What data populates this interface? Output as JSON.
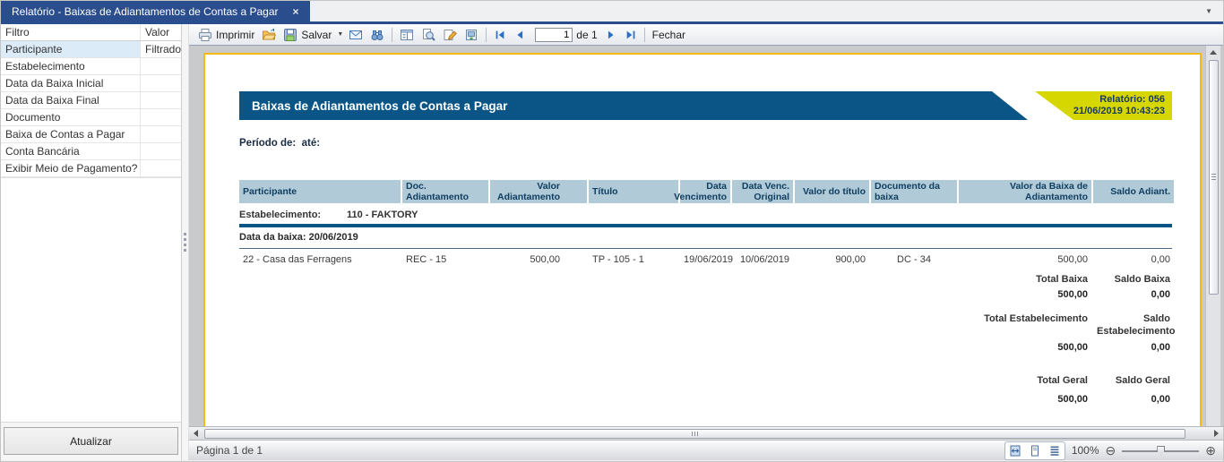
{
  "window": {
    "tab_title": "Relatório - Baixas de Adiantamentos de Contas a Pagar",
    "close_glyph": "×",
    "overflow_glyph": "▼"
  },
  "sidebar": {
    "header": {
      "filtro": "Filtro",
      "valor": "Valor"
    },
    "rows": [
      {
        "filtro": "Participante",
        "valor": "Filtrado"
      },
      {
        "filtro": "Estabelecimento",
        "valor": ""
      },
      {
        "filtro": "Data da Baixa Inicial",
        "valor": ""
      },
      {
        "filtro": "Data da Baixa Final",
        "valor": ""
      },
      {
        "filtro": "Documento",
        "valor": ""
      },
      {
        "filtro": "Baixa de Contas a Pagar",
        "valor": ""
      },
      {
        "filtro": "Conta Bancária",
        "valor": ""
      },
      {
        "filtro": "Exibir Meio de Pagamento?",
        "valor": ""
      }
    ],
    "update_button_label": "Atualizar"
  },
  "toolbar": {
    "print_label": "Imprimir",
    "save_label": "Salvar",
    "save_caret_glyph": "▼",
    "page_value": "1",
    "page_count_label": "de 1",
    "close_label": "Fechar"
  },
  "report": {
    "title": "Baixas de Adiantamentos de Contas a Pagar",
    "badge": {
      "line1": "Relatório: 056",
      "line2": "21/06/2019 10:43:23"
    },
    "period_label": "Período de:  até:",
    "columns": [
      "Participante",
      "Doc. Adiantamento",
      "Valor Adiantamento",
      "Título",
      "Data\nVencimento",
      "Data Venc.\nOriginal",
      "Valor do título",
      "Documento da baixa",
      "Valor da Baixa de Adiantamento",
      "Saldo Adiant."
    ],
    "establishment": {
      "label": "Estabelecimento:",
      "value": "110 - FAKTORY"
    },
    "group_label": "Data da baixa: 20/06/2019",
    "rows": [
      {
        "participante": "22 - Casa das Ferragens",
        "doc_adiantamento": "REC - 15",
        "valor_adiantamento": "500,00",
        "titulo": "TP - 105 - 1",
        "data_vencimento": "19/06/2019",
        "data_venc_original": "10/06/2019",
        "valor_titulo": "900,00",
        "documento_baixa": "DC - 34",
        "valor_baixa": "500,00",
        "saldo_adiant": "0,00"
      }
    ],
    "totals": [
      {
        "label_a": "Total Baixa",
        "value_a": "500,00",
        "label_b": "Saldo Baixa",
        "value_b": "0,00"
      },
      {
        "label_a": "Total Estabelecimento",
        "value_a": "500,00",
        "label_b": "Saldo Estabelecimento",
        "value_b": "0,00"
      },
      {
        "label_a": "Total Geral",
        "value_a": "500,00",
        "label_b": "Saldo Geral",
        "value_b": "0,00"
      }
    ]
  },
  "statusbar": {
    "page_info": "Página 1 de 1",
    "zoom_value": "100%",
    "zoom_out_glyph": "⊖",
    "zoom_in_glyph": "⊕"
  },
  "colors": {
    "tab_navy": "#2a4d8d",
    "report_blue": "#0b5586",
    "badge_yellow": "#d6d600",
    "header_cell_bg": "#b0cad8",
    "page_border_orange": "#f5b915"
  }
}
